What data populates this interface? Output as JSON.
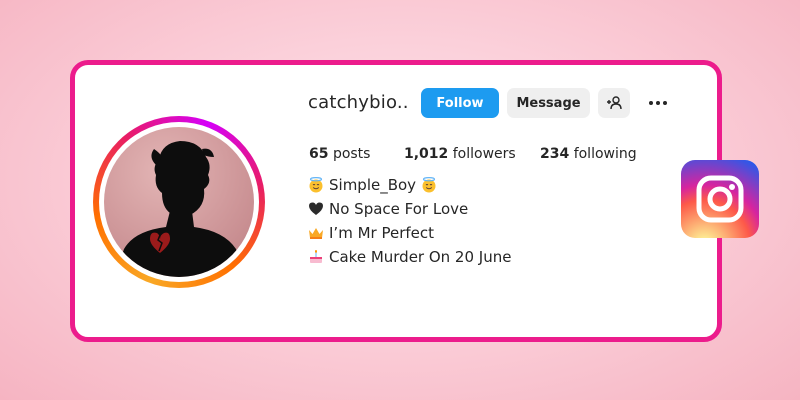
{
  "profile": {
    "username": "catchybio..",
    "follow_label": "Follow",
    "message_label": "Message"
  },
  "stats": {
    "posts_count": "65",
    "posts_label": "posts",
    "followers_count": "1,012",
    "followers_label": "followers",
    "following_count": "234",
    "following_label": "following"
  },
  "bio": {
    "line1": "Simple_Boy",
    "line2": "No Space For Love",
    "line3": "I’m Mr Perfect",
    "line4": "Cake Murder On 20 June"
  },
  "icons": {
    "line1_left": "smiling-face-with-halo",
    "line1_right": "smiling-face-with-halo",
    "line2": "black-heart",
    "line3": "crown",
    "line4": "birthday-cake",
    "add_user": "add-person-icon",
    "more": "more-options-icon",
    "brand": "instagram-logo"
  },
  "colors": {
    "card_border": "#ec1c8c",
    "follow_button": "#1d9bf0",
    "secondary_button": "#efefef"
  }
}
